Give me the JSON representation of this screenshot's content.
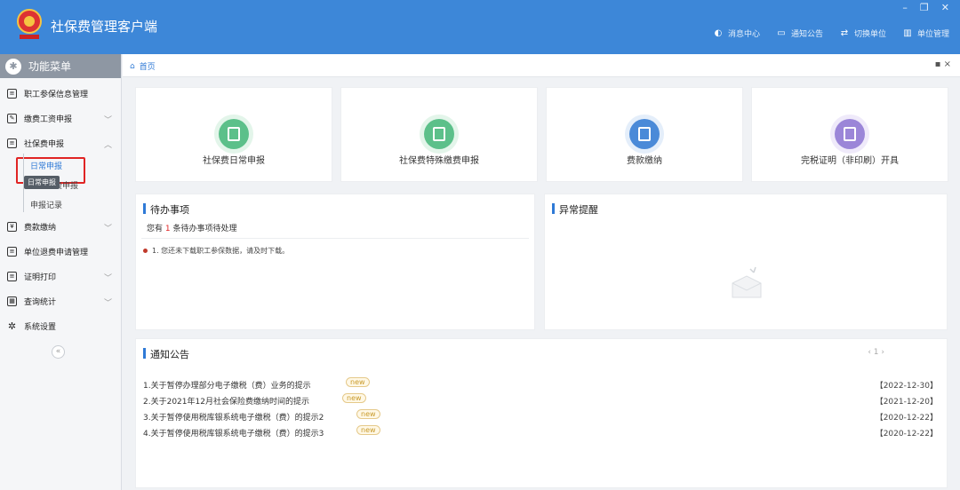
{
  "header": {
    "title": "社保费管理客户端",
    "logo_icon": "tax-emblem-icon",
    "nav": [
      {
        "label": "消息中心",
        "icon": "message-icon"
      },
      {
        "label": "通知公告",
        "icon": "notice-icon"
      },
      {
        "label": "切换单位",
        "icon": "switch-icon"
      },
      {
        "label": "单位管理",
        "icon": "building-icon"
      }
    ],
    "window_controls": [
      "–",
      "❐",
      "✕"
    ]
  },
  "sidebar": {
    "title": "功能菜单",
    "items": [
      {
        "label": "职工参保信息管理"
      },
      {
        "label": "缴费工资申报",
        "chevron": "﹀"
      },
      {
        "label": "社保费申报",
        "chevron": "︿"
      },
      {
        "label": "费款缴纳",
        "chevron": "﹀"
      },
      {
        "label": "单位退费申请管理"
      },
      {
        "label": "证明打印",
        "chevron": "﹀"
      },
      {
        "label": "查询统计",
        "chevron": "﹀"
      },
      {
        "label": "系统设置"
      }
    ],
    "sub_items": [
      "日常申报",
      "特殊缴费申报",
      "申报记录"
    ],
    "tooltip": "日常申报",
    "collapse": "«"
  },
  "tabs": {
    "home": "首页",
    "close": "▪ ×"
  },
  "quick_actions": [
    {
      "label": "社保费日常申报",
      "color": "#5cc08a"
    },
    {
      "label": "社保费特殊缴费申报",
      "color": "#5cc08a"
    },
    {
      "label": "费款缴纳",
      "color": "#4a8ad8"
    },
    {
      "label": "完税证明（非印刷）开具",
      "color": "#9b86d8"
    }
  ],
  "todo": {
    "title": "待办事项",
    "summary_prefix": "您有",
    "count": "1",
    "summary_suffix": "条待办事项待处理",
    "items": [
      "1. 您还未下载职工参保数据，请及时下载。"
    ]
  },
  "alerts": {
    "title": "异常提醒"
  },
  "notices": {
    "title": "通知公告",
    "pager": "‹ 1 ›",
    "badge": "new",
    "rows": [
      {
        "title": "1.关于暂停办理部分电子缴税（费）业务的提示",
        "date": "【2022-12-30】"
      },
      {
        "title": "2.关于2021年12月社会保险费缴纳时间的提示",
        "date": "【2021-12-20】"
      },
      {
        "title": "3.关于暂停使用税库银系统电子缴税（费）的提示2",
        "date": "【2020-12-22】"
      },
      {
        "title": "4.关于暂停使用税库银系统电子缴税（费）的提示3",
        "date": "【2020-12-22】"
      }
    ]
  }
}
